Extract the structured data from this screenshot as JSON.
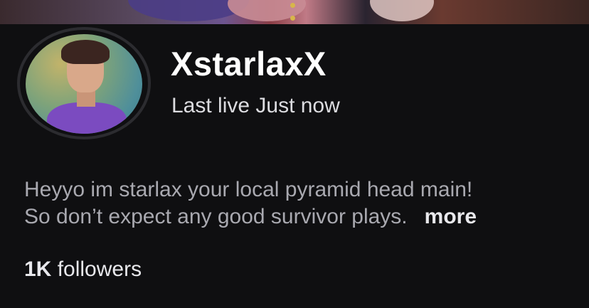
{
  "profile": {
    "username": "XstarlaxX",
    "last_live": "Last live Just now",
    "bio_line1": "Heyyo im starlax your local pyramid head main!",
    "bio_line2": "So don’t expect any good survivor plays.",
    "more_label": "more",
    "followers_count": "1K",
    "followers_label": "followers"
  }
}
